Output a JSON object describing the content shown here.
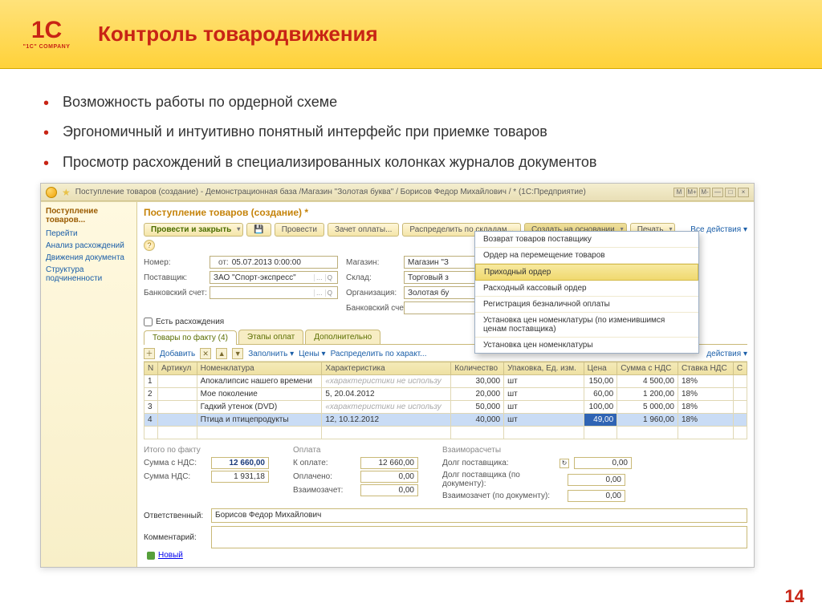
{
  "logo_text": "1C",
  "logo_sub": "\"1C\" COMPANY",
  "slide_title": "Контроль товародвижения",
  "bullets": [
    "Возможность работы по ордерной схеме",
    "Эргономичный и интуитивно понятный интерфейс при приемке товаров",
    "Просмотр расхождений в специализированных колонках журналов документов"
  ],
  "titlebar": "Поступление товаров (создание) - Демонстрационная база /Магазин \"Золотая буква\" / Борисов Федор Михайлович / * (1С:Предприятие)",
  "win_btns": [
    "M",
    "M+",
    "M-",
    "—",
    "□",
    "×"
  ],
  "left_nav": {
    "title": "Поступление товаров...",
    "items": [
      "Перейти",
      "Анализ расхождений",
      "Движения документа",
      "Структура подчиненности"
    ]
  },
  "doc_title": "Поступление товаров (создание) *",
  "toolbar": {
    "main": "Провести и закрыть",
    "post": "Провести",
    "offset": "Зачет оплаты...",
    "distribute": "Распределить по складам...",
    "create_based": "Создать на основании",
    "print": "Печать",
    "all_actions": "Все действия"
  },
  "form": {
    "number_lbl": "Номер:",
    "number": "",
    "date_lbl": "от:",
    "date": "05.07.2013 0:00:00",
    "store_lbl": "Магазин:",
    "store": "Магазин \"З",
    "supplier_lbl": "Поставщик:",
    "supplier": "ЗАО \"Спорт-экспресс\"",
    "warehouse_lbl": "Склад:",
    "warehouse": "Торговый з",
    "bankacc_lbl": "Банковский счет:",
    "bankacc": "",
    "org_lbl": "Организация:",
    "org": "Золотая бу",
    "bankacc2_lbl": "Банковский счет:",
    "bankacc2": "",
    "discrep_chk": "Есть расхождения"
  },
  "tabs": [
    "Товары по факту (4)",
    "Этапы оплат",
    "Дополнительно"
  ],
  "grid_toolbar": {
    "add": "Добавить",
    "fill": "Заполнить",
    "prices": "Цены",
    "spread": "Распределить по характ...",
    "actions": "действия"
  },
  "grid": {
    "cols": [
      "N",
      "Артикул",
      "Номенклатура",
      "Характеристика",
      "Количество",
      "Упаковка, Ед. изм.",
      "Цена",
      "Сумма с НДС",
      "Ставка НДС",
      "С"
    ],
    "rows": [
      {
        "n": "1",
        "art": "",
        "nom": "Апокалипсис нашего времени",
        "har": "«характеристики не использу",
        "qty": "30,000",
        "unit": "шт",
        "price": "150,00",
        "sum": "4 500,00",
        "vat": "18%"
      },
      {
        "n": "2",
        "art": "",
        "nom": "Мое поколение",
        "har": "5, 20.04.2012",
        "qty": "20,000",
        "unit": "шт",
        "price": "60,00",
        "sum": "1 200,00",
        "vat": "18%"
      },
      {
        "n": "3",
        "art": "",
        "nom": "Гадкий утенок (DVD)",
        "har": "«характеристики не использу",
        "qty": "50,000",
        "unit": "шт",
        "price": "100,00",
        "sum": "5 000,00",
        "vat": "18%"
      },
      {
        "n": "4",
        "art": "",
        "nom": "Птица и птицепродукты",
        "har": "12, 10.12.2012",
        "qty": "40,000",
        "unit": "шт",
        "price": "49,00",
        "sum": "1 960,00",
        "vat": "18%"
      }
    ]
  },
  "totals": {
    "fact_lbl": "Итого по факту",
    "sum_nds_lbl": "Сумма с НДС:",
    "sum_nds": "12 660,00",
    "nds_lbl": "Сумма НДС:",
    "nds": "1 931,18",
    "pay_lbl": "Оплата",
    "to_pay_lbl": "К оплате:",
    "to_pay": "12 660,00",
    "paid_lbl": "Оплачено:",
    "paid": "0,00",
    "offset_lbl": "Взаимозачет:",
    "offset": "0,00",
    "settle_lbl": "Взаиморасчеты",
    "debt_lbl": "Долг поставщика:",
    "debt": "0,00",
    "debt_doc_lbl": "Долг поставщика (по документу):",
    "debt_doc": "0,00",
    "offset_doc_lbl": "Взаимозачет (по документу):",
    "offset_doc": "0,00"
  },
  "bottom": {
    "resp_lbl": "Ответственный:",
    "resp": "Борисов Федор Михайлович",
    "comment_lbl": "Комментарий:",
    "comment": ""
  },
  "status": "Новый",
  "dropdown": {
    "items": [
      "Возврат товаров поставщику",
      "Ордер на перемещение товаров",
      "Приходный ордер",
      "Расходный кассовый ордер",
      "Регистрация безналичной оплаты",
      "Установка цен номенклатуры (по изменившимся ценам поставщика)",
      "Установка цен номенклатуры"
    ],
    "selected_index": 2
  },
  "page_number": "14"
}
